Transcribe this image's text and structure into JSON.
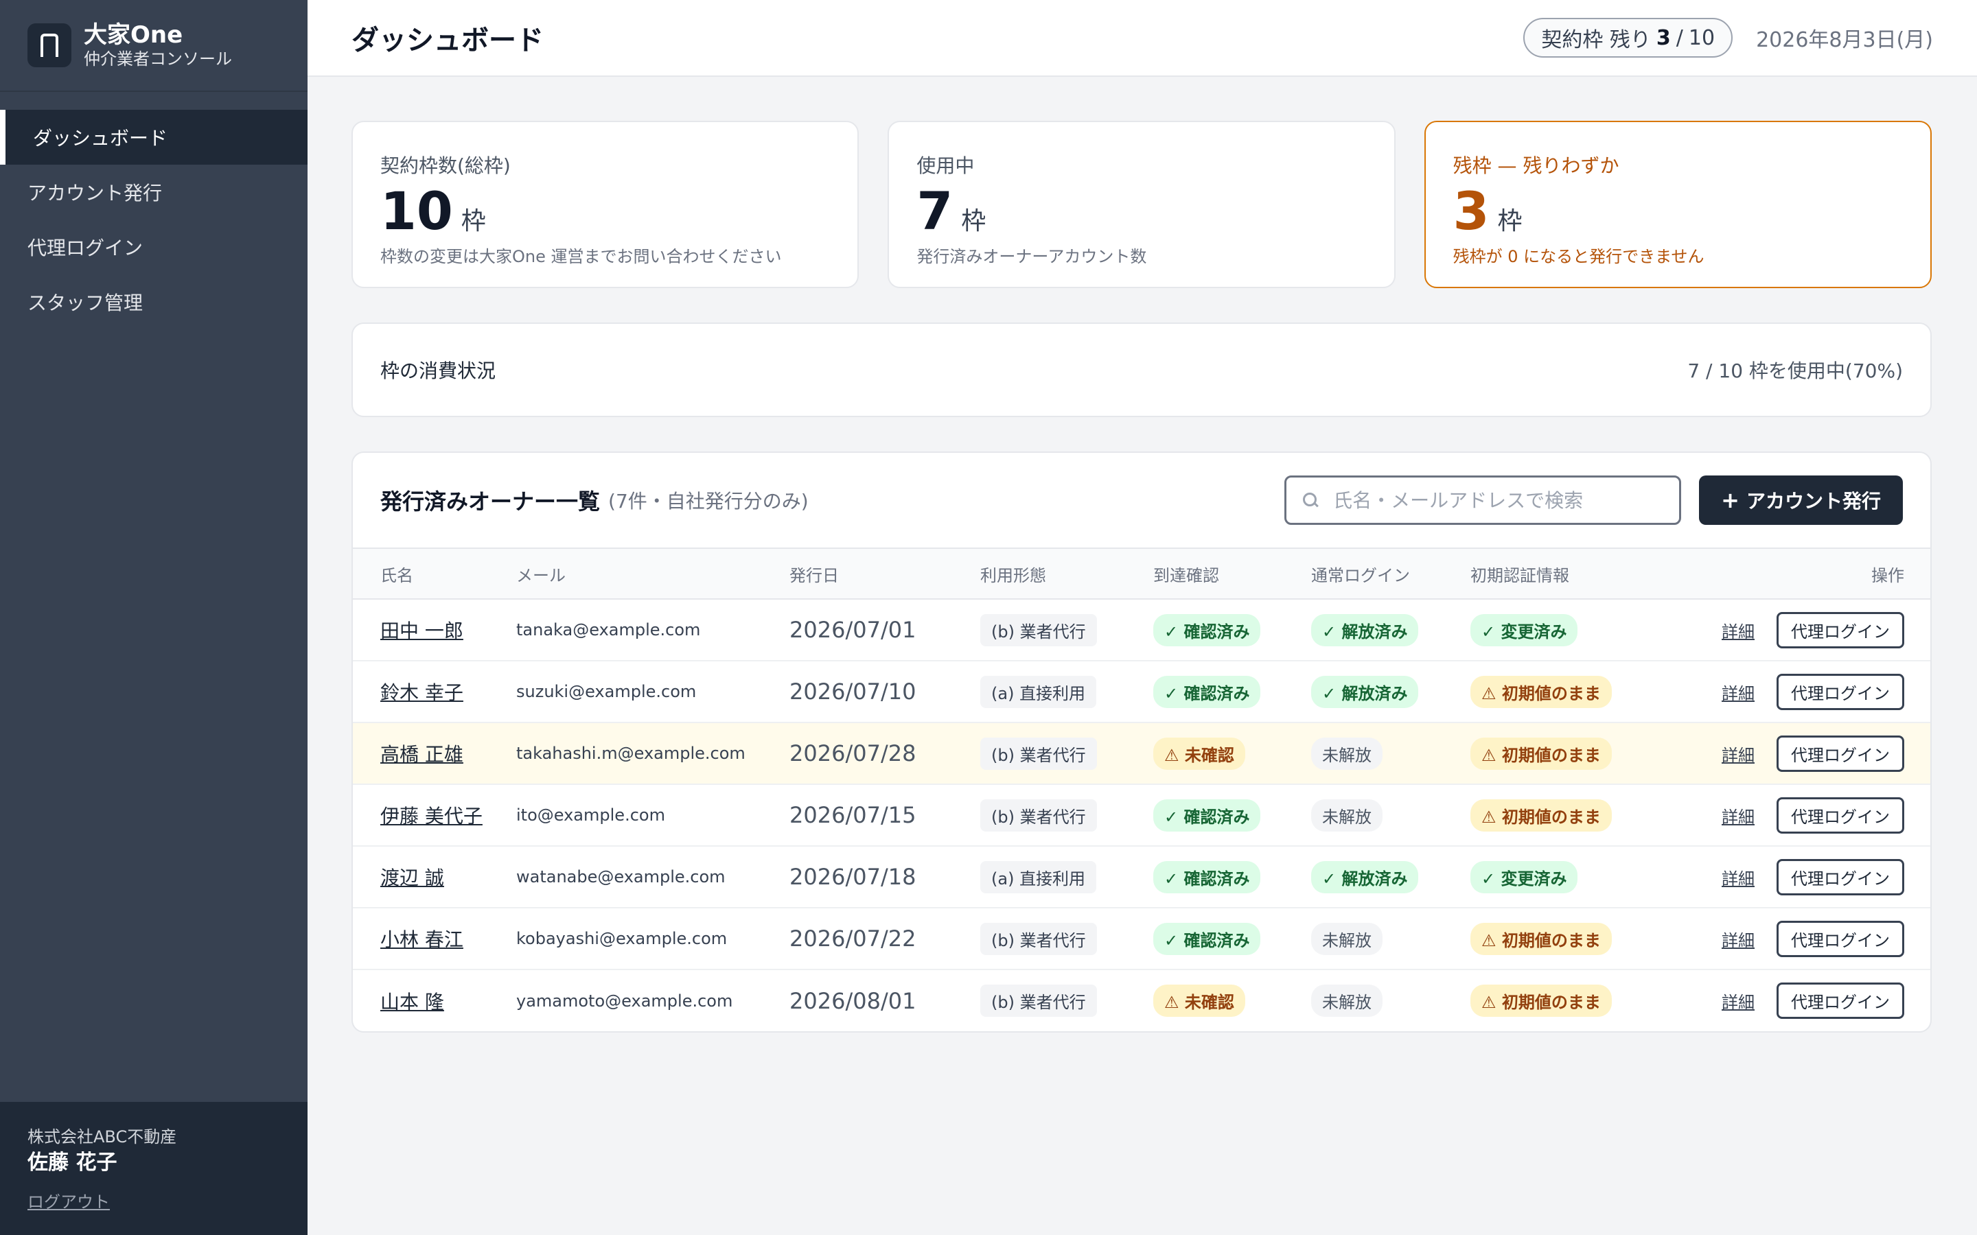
{
  "sidebar": {
    "brand_title": "大家One",
    "brand_sub": "仲介業者コンソール",
    "items": [
      {
        "label": "ダッシュボード",
        "active": true
      },
      {
        "label": "アカウント発行"
      },
      {
        "label": "代理ログイン"
      },
      {
        "label": "スタッフ管理"
      }
    ],
    "company": "株式会社ABC不動産",
    "user": "佐藤 花子",
    "logout": "ログアウト"
  },
  "header": {
    "title": "ダッシュボード",
    "quota_label": "契約枠 残り",
    "quota_remaining": "3",
    "quota_sep": "/",
    "quota_total": "10",
    "date": "2026年8月3日(月)"
  },
  "cards": [
    {
      "label": "契約枠数(総枠)",
      "value": "10",
      "unit": "枠",
      "note": "枠数の変更は大家One 運営までお問い合わせください"
    },
    {
      "label": "使用中",
      "value": "7",
      "unit": "枠",
      "note": "発行済みオーナーアカウント数"
    },
    {
      "label": "残枠 — 残りわずか",
      "value": "3",
      "unit": "枠",
      "note": "残枠が 0 になると発行できません"
    }
  ],
  "usage": {
    "title": "枠の消費状況",
    "summary": "7 / 10 枠を使用中(70%)"
  },
  "owners": {
    "title": "発行済みオーナー一覧",
    "subtitle": "(7件・自社発行分のみ)",
    "search_placeholder": "氏名・メールアドレスで検索",
    "issue_button": "アカウント発行",
    "columns": [
      "氏名",
      "メール",
      "発行日",
      "利用形態",
      "到達確認",
      "通常ログイン",
      "初期認証情報",
      "操作"
    ],
    "detail_label": "詳細",
    "proxy_label": "代理ログイン",
    "rows": [
      {
        "name": "田中 一郎",
        "email": "tanaka@example.com",
        "date": "2026/07/01",
        "usage": "(b) 業者代行",
        "delivery": "✓ 確認済み",
        "login": "✓ 解放済み",
        "credential": "✓ 変更済み"
      },
      {
        "name": "鈴木 幸子",
        "email": "suzuki@example.com",
        "date": "2026/07/10",
        "usage": "(a) 直接利用",
        "delivery": "✓ 確認済み",
        "login": "✓ 解放済み",
        "credential": "⚠ 初期値のまま"
      },
      {
        "name": "高橋 正雄",
        "email": "takahashi.m@example.com",
        "date": "2026/07/28",
        "usage": "(b) 業者代行",
        "delivery": "⚠ 未確認",
        "login": "未解放",
        "credential": "⚠ 初期値のまま"
      },
      {
        "name": "伊藤 美代子",
        "email": "ito@example.com",
        "date": "2026/07/15",
        "usage": "(b) 業者代行",
        "delivery": "✓ 確認済み",
        "login": "未解放",
        "credential": "⚠ 初期値のまま"
      },
      {
        "name": "渡辺 誠",
        "email": "watanabe@example.com",
        "date": "2026/07/18",
        "usage": "(a) 直接利用",
        "delivery": "✓ 確認済み",
        "login": "✓ 解放済み",
        "credential": "✓ 変更済み"
      },
      {
        "name": "小林 春江",
        "email": "kobayashi@example.com",
        "date": "2026/07/22",
        "usage": "(b) 業者代行",
        "delivery": "✓ 確認済み",
        "login": "未解放",
        "credential": "⚠ 初期値のまま"
      },
      {
        "name": "山本 隆",
        "email": "yamamoto@example.com",
        "date": "2026/08/01",
        "usage": "(b) 業者代行",
        "delivery": "⚠ 未確認",
        "login": "未解放",
        "credential": "⚠ 初期値のまま"
      }
    ]
  }
}
